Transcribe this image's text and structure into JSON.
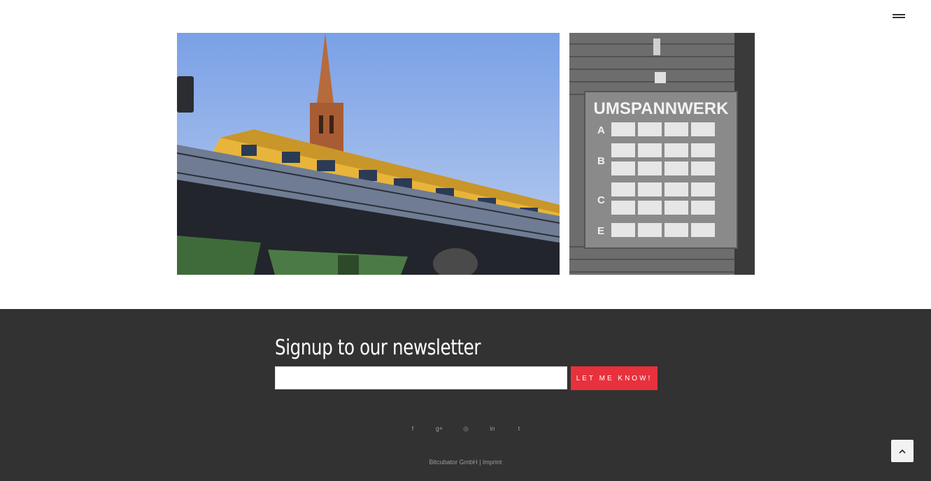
{
  "header": {
    "menu_icon": "hamburger-icon"
  },
  "gallery": {
    "images": [
      {
        "name": "elevated-yellow-train-church-photo"
      },
      {
        "name": "umspannwerk-sign-photo",
        "sign_text": "UMSPANNWERK",
        "rows": [
          "A",
          "B",
          "C",
          "E"
        ]
      }
    ]
  },
  "newsletter": {
    "title": "Signup to our newsletter",
    "email_value": "",
    "email_placeholder": "",
    "submit_label": "LET ME KNOW!"
  },
  "social": [
    {
      "name": "facebook-icon",
      "glyph": "f"
    },
    {
      "name": "google-plus-icon",
      "glyph": "g+"
    },
    {
      "name": "instagram-icon",
      "glyph": "◎"
    },
    {
      "name": "linkedin-icon",
      "glyph": "in"
    },
    {
      "name": "twitter-icon",
      "glyph": "t"
    }
  ],
  "footer": {
    "company": "Bitcubator GmbH",
    "separator": " | ",
    "imprint_label": "Imprint"
  },
  "back_to_top_icon": "chevron-up-icon",
  "colors": {
    "footer_bg": "#323232",
    "accent": "#e8313c",
    "muted_text": "#9a9a9a"
  }
}
